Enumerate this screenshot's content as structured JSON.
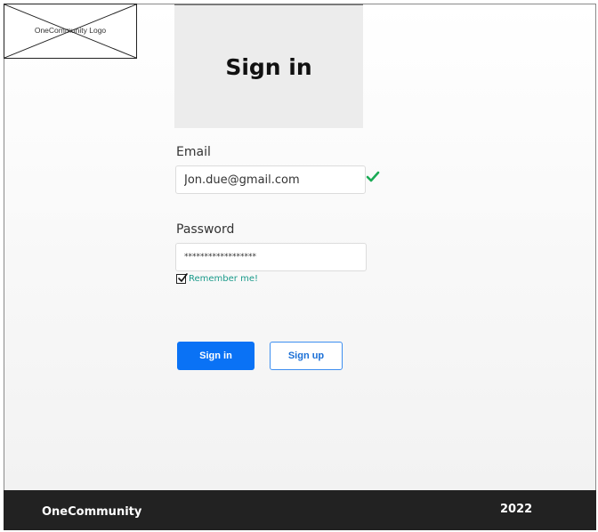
{
  "header": {
    "logo_text": "OneCommunity Logo",
    "title": "Sign in"
  },
  "form": {
    "email_label": "Email",
    "email_value": "Jon.due@gmail.com",
    "email_valid_icon": "checkmark-icon",
    "password_label": "Password",
    "password_value": "******************",
    "remember_label": "Remember me!",
    "remember_checked": true
  },
  "actions": {
    "signin_label": "Sign in",
    "signup_label": "Sign up"
  },
  "footer": {
    "brand": "OneCommunity",
    "year": "2022"
  },
  "colors": {
    "primary": "#0a72f5",
    "success": "#1aaa55",
    "footer_bg": "#222222",
    "remember_text": "#1a9a8a"
  }
}
